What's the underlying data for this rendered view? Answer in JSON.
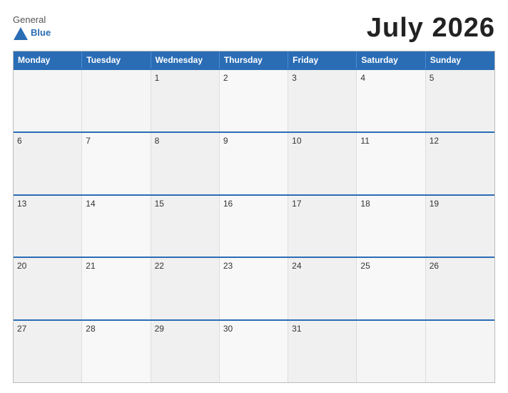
{
  "header": {
    "logo": {
      "general": "General",
      "blue": "Blue",
      "triangle_color": "#2a6db5"
    },
    "title": "July 2026"
  },
  "calendar": {
    "days_of_week": [
      "Monday",
      "Tuesday",
      "Wednesday",
      "Thursday",
      "Friday",
      "Saturday",
      "Sunday"
    ],
    "weeks": [
      [
        null,
        null,
        1,
        2,
        3,
        4,
        5
      ],
      [
        6,
        7,
        8,
        9,
        10,
        11,
        12
      ],
      [
        13,
        14,
        15,
        16,
        17,
        18,
        19
      ],
      [
        20,
        21,
        22,
        23,
        24,
        25,
        26
      ],
      [
        27,
        28,
        29,
        30,
        31,
        null,
        null
      ]
    ]
  }
}
